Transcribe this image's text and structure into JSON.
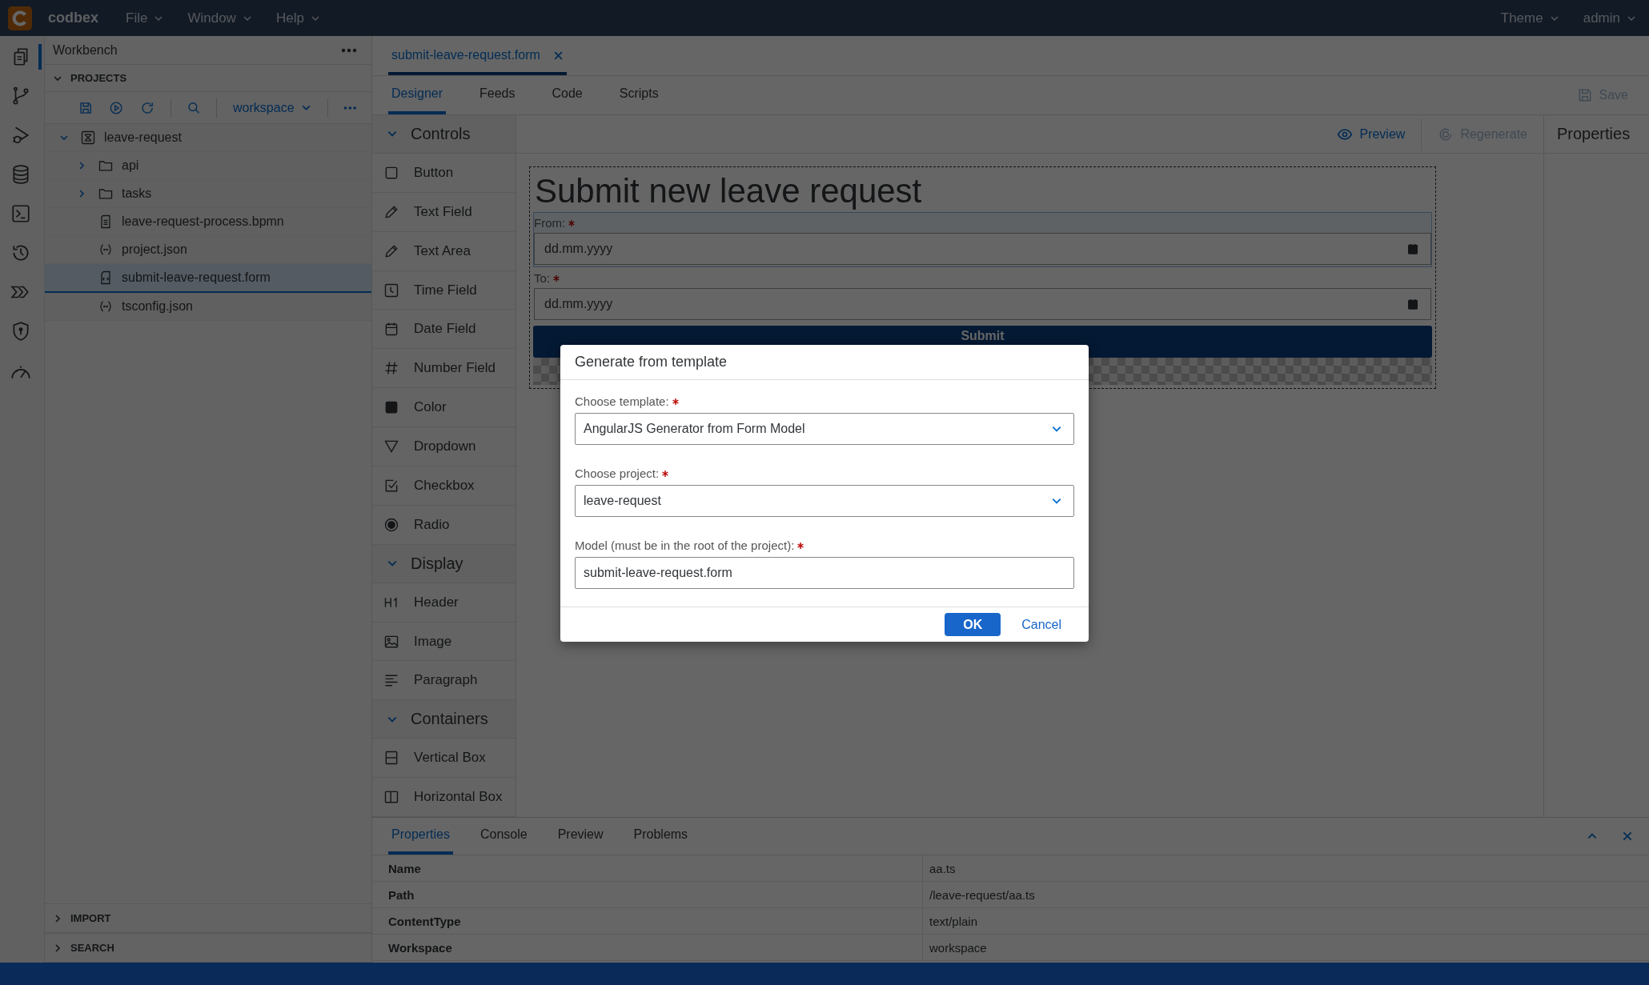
{
  "app": {
    "name": "codbex",
    "menus": [
      {
        "label": "File"
      },
      {
        "label": "Window"
      },
      {
        "label": "Help"
      }
    ],
    "right_menus": [
      {
        "label": "Theme"
      },
      {
        "label": "admin"
      }
    ]
  },
  "activity_bar": [
    {
      "kind": "files",
      "selected": true
    },
    {
      "kind": "git",
      "selected": false
    },
    {
      "kind": "debug",
      "selected": false
    },
    {
      "kind": "database",
      "selected": false
    },
    {
      "kind": "terminal",
      "selected": false
    },
    {
      "kind": "history",
      "selected": false
    },
    {
      "kind": "pipeline",
      "selected": false
    },
    {
      "kind": "security",
      "selected": false
    },
    {
      "kind": "monitor",
      "selected": false
    }
  ],
  "sidebar": {
    "title": "Workbench",
    "section": {
      "label": "PROJECTS",
      "expanded": true
    },
    "workspace": "workspace",
    "tree": [
      {
        "label": "leave-request",
        "kind": "project",
        "expanded": true,
        "selected": false,
        "children": [
          {
            "label": "api",
            "kind": "folder",
            "expanded": false,
            "selected": false
          },
          {
            "label": "tasks",
            "kind": "folder",
            "expanded": false,
            "selected": false
          },
          {
            "label": "leave-request-process.bpmn",
            "kind": "file",
            "selected": false
          },
          {
            "label": "project.json",
            "kind": "json",
            "selected": false
          },
          {
            "label": "submit-leave-request.form",
            "kind": "form",
            "selected": true
          },
          {
            "label": "tsconfig.json",
            "kind": "json",
            "selected": false
          }
        ]
      }
    ],
    "collapsed_sections": [
      {
        "label": "IMPORT",
        "expanded": false
      },
      {
        "label": "SEARCH",
        "expanded": false
      }
    ]
  },
  "editor": {
    "tabs": [
      {
        "label": "submit-leave-request.form",
        "selected": true
      }
    ],
    "subtabs": [
      {
        "label": "Designer",
        "selected": true
      },
      {
        "label": "Feeds",
        "selected": false
      },
      {
        "label": "Code",
        "selected": false
      },
      {
        "label": "Scripts",
        "selected": false
      }
    ],
    "save": {
      "label": "Save",
      "disabled": true
    },
    "toolbar": [
      {
        "label": "Preview",
        "kind": "preview",
        "disabled": false
      },
      {
        "label": "Regenerate",
        "kind": "regenerate",
        "disabled": true
      }
    ],
    "palette": [
      {
        "title": "Controls",
        "expanded": true,
        "items": [
          {
            "label": "Button",
            "kind": "button"
          },
          {
            "label": "Text Field",
            "kind": "pencil"
          },
          {
            "label": "Text Area",
            "kind": "pencil"
          },
          {
            "label": "Time Field",
            "kind": "clock"
          },
          {
            "label": "Date Field",
            "kind": "calendar"
          },
          {
            "label": "Number Field",
            "kind": "number"
          },
          {
            "label": "Color",
            "kind": "color"
          },
          {
            "label": "Dropdown",
            "kind": "dropdown"
          },
          {
            "label": "Checkbox",
            "kind": "checkbox"
          },
          {
            "label": "Radio",
            "kind": "radio"
          }
        ]
      },
      {
        "title": "Display",
        "expanded": true,
        "items": [
          {
            "label": "Header",
            "kind": "header"
          },
          {
            "label": "Image",
            "kind": "image"
          },
          {
            "label": "Paragraph",
            "kind": "paragraph"
          }
        ]
      },
      {
        "title": "Containers",
        "expanded": true,
        "items": [
          {
            "label": "Vertical Box",
            "kind": "vbox"
          },
          {
            "label": "Horizontal Box",
            "kind": "hbox"
          }
        ]
      }
    ],
    "form": {
      "header": "Submit new leave request",
      "fields": [
        {
          "label": "From:",
          "required": true,
          "placeholder": "dd.mm.yyyy",
          "selected": true
        },
        {
          "label": "To:",
          "required": true,
          "placeholder": "dd.mm.yyyy",
          "selected": false
        }
      ],
      "button": "Submit"
    },
    "properties_title": "Properties"
  },
  "bottom_panel": {
    "tabs": [
      {
        "label": "Properties",
        "selected": true
      },
      {
        "label": "Console",
        "selected": false
      },
      {
        "label": "Preview",
        "selected": false
      },
      {
        "label": "Problems",
        "selected": false
      }
    ],
    "rows": [
      {
        "name": "Name",
        "value": "aa.ts"
      },
      {
        "name": "Path",
        "value": "/leave-request/aa.ts"
      },
      {
        "name": "ContentType",
        "value": "text/plain"
      },
      {
        "name": "Workspace",
        "value": "workspace"
      }
    ]
  },
  "dialog": {
    "title": "Generate from template",
    "fields": [
      {
        "label": "Choose template:",
        "required": true,
        "kind": "select",
        "value": "AngularJS Generator from Form Model"
      },
      {
        "label": "Choose project:",
        "required": true,
        "kind": "select",
        "value": "leave-request"
      },
      {
        "label": "Model (must be in the root of the project):",
        "required": true,
        "kind": "input",
        "value": "submit-leave-request.form"
      }
    ],
    "buttons": [
      {
        "label": "OK",
        "kind": "primary"
      },
      {
        "label": "Cancel",
        "kind": "transparent"
      }
    ]
  }
}
